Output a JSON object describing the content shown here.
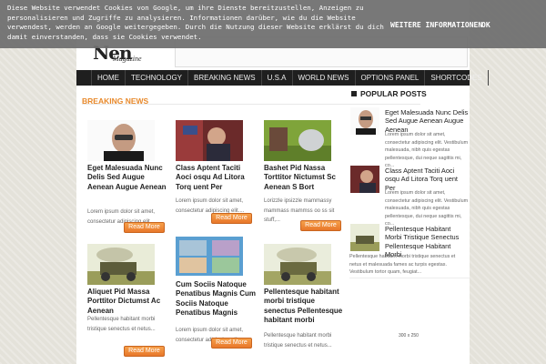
{
  "cookie": {
    "text": "Diese Website verwendet Cookies von Google, um ihre Dienste bereitzustellen, Anzeigen zu personalisieren und Zugriffe zu analysieren. Informationen darüber, wie du die Website verwendest, werden an Google weitergegeben. Durch die Nutzung dieser Website erklärst du dich damit einverstanden, dass sie Cookies verwendet.",
    "more": "WEITERE INFORMATIONEN",
    "ok": "OK"
  },
  "header": {
    "logo": "Nen",
    "logo_sub": "Magazine"
  },
  "nav": [
    "HOME",
    "TECHNOLOGY",
    "BREAKING NEWS",
    "U.S.A",
    "WORLD NEWS",
    "OPTIONS PANEL",
    "SHORTCODES"
  ],
  "breaking": {
    "title": "BREAKING NEWS",
    "read_more": "Read More",
    "cards": [
      {
        "title": "Eget Malesuada Nunc Delis Sed Augue Aenean Augue Aenean",
        "excerpt": "Lorem ipsum dolor sit amet, consectetur adipiscing elit...."
      },
      {
        "title": "Class Aptent Taciti Aoci osqu Ad Litora Torq uent Per",
        "excerpt": "Lorem ipsum dolor sit amet, consectetur adipiscing elit...."
      },
      {
        "title": "Bashet Pid Nassa Torttitor Nictumst Sc Aenean S Bort",
        "excerpt": "Lorizzle ipsizzle mammassy mammass mammss oo ss sit stuff,..."
      },
      {
        "title": "Aliquet Pid Massa Porttitor Dictumst Ac Aenean",
        "excerpt": "Pellentesque habitant morbi tristique senectus et netus..."
      },
      {
        "title": "Cum Sociis Natoque Penatibus Magnis Cum Sociis Natoque Penatibus Magnis",
        "excerpt": "Lorem ipsum dolor sit amet, consectetur adipiscing elit...."
      },
      {
        "title": "Pellentesque habitant morbi tristique senectus Pellentesque habitant morbi",
        "excerpt": "Pellentesque habitant morbi tristique senectus et netus..."
      }
    ]
  },
  "popular": {
    "title": "POPULAR POSTS",
    "items": [
      {
        "title": "Eget Malesuada Nunc Delis Sed Augue Aenean Augue Aenean",
        "excerpt": "Lorem ipsum dolor sit amet, consectetur adipiscing elit. Vestibulum malesuada, nibh quis egestas pellentesque, dui neque sagittis mi, co..."
      },
      {
        "title": "Class Aptent Taciti Aoci osqu Ad Litora Torq uent Per",
        "excerpt": "Lorem ipsum dolor sit amet, consectetur adipiscing elit. Vestibulum malesuada, nibh quis egestas pellentesque, dui neque sagittis mi, co..."
      },
      {
        "title": "Pellentesque Habitant Morbi Tristique Senectus Pellentesque Habitant Morbi",
        "excerpt": "Pellentesque habitant morbi tristique senectus et netus et malesuada fames ac turpis egestas. Vestibulum tortor quam, feugiat..."
      }
    ]
  },
  "ad": {
    "label": "300 x 250"
  }
}
